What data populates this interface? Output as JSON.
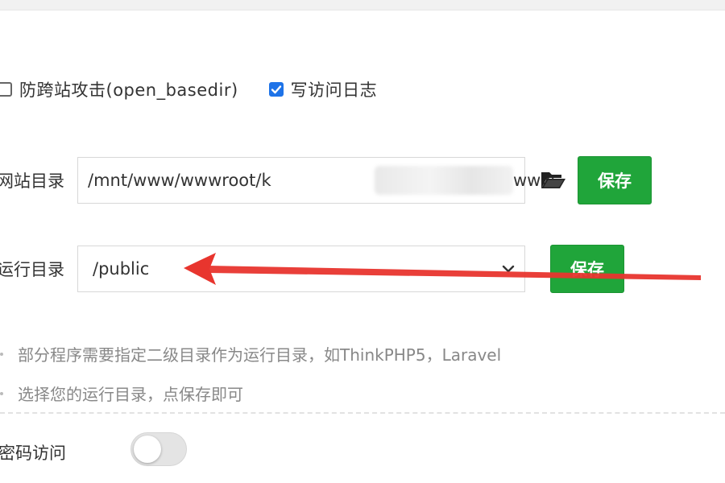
{
  "options": {
    "anti_xss": {
      "label": "防跨站攻击(open_basedir)",
      "checked": false
    },
    "write_log": {
      "label": "写访问日志",
      "checked": true
    }
  },
  "site_dir": {
    "label": "网站目录",
    "value_prefix": "/mnt/www/wwwroot/k",
    "value_suffix": "www",
    "save_label": "保存",
    "folder_icon": "folder-icon"
  },
  "run_dir": {
    "label": "运行目录",
    "value": "/public",
    "save_label": "保存"
  },
  "tips": [
    "部分程序需要指定二级目录作为运行目录，如ThinkPHP5，Laravel",
    "选择您的运行目录，点保存即可"
  ],
  "password_access": {
    "label": "密码访问",
    "enabled": false
  },
  "colors": {
    "accent_green": "#20a53a",
    "checkbox_blue": "#1e73e8",
    "annotation_red": "#e8352e"
  }
}
